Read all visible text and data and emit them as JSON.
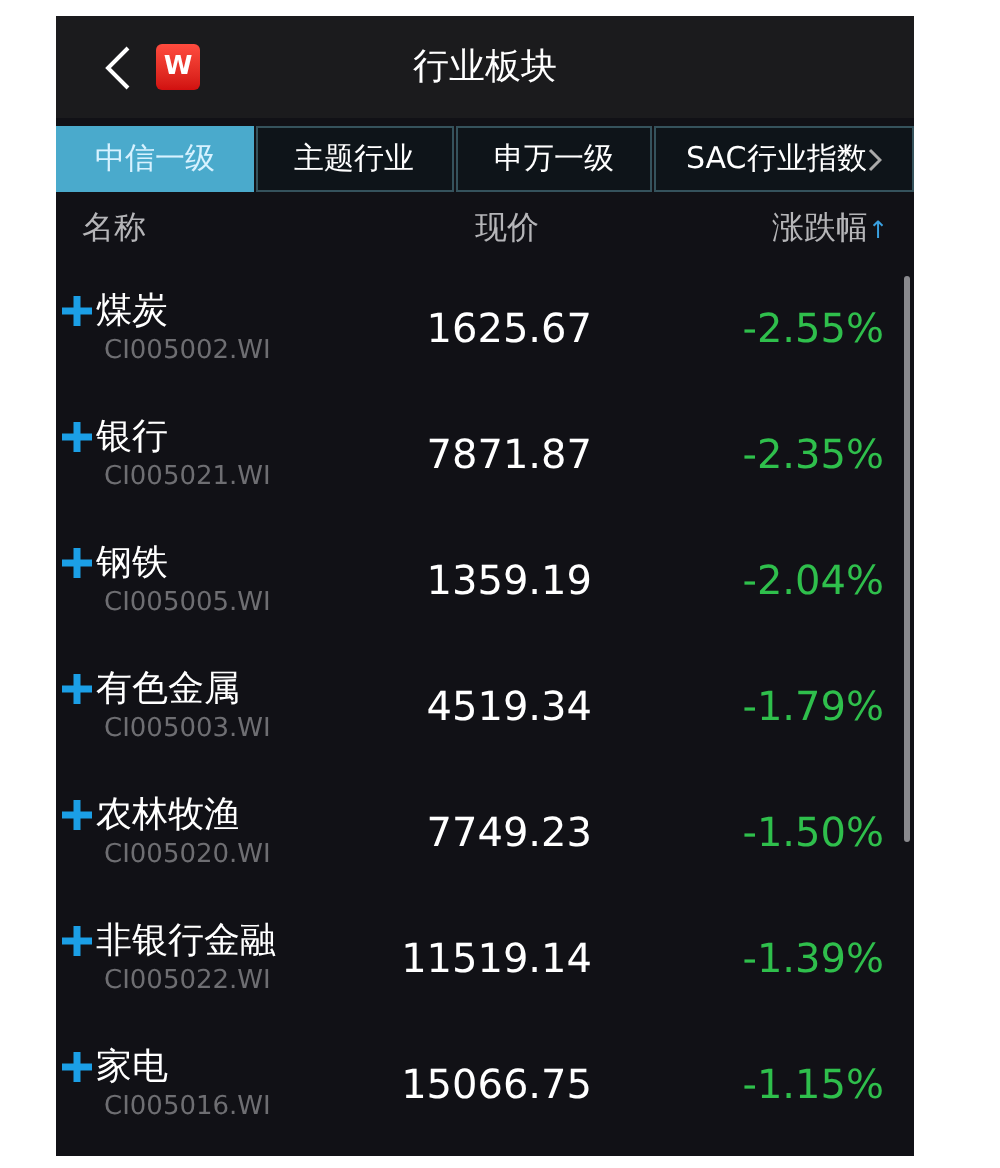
{
  "header": {
    "title": "行业板块",
    "logo_text": "W"
  },
  "tabs": [
    {
      "label": "中信一级",
      "selected": true
    },
    {
      "label": "主题行业",
      "selected": false
    },
    {
      "label": "申万一级",
      "selected": false
    },
    {
      "label": "SAC行业指数",
      "selected": false
    }
  ],
  "table": {
    "columns": [
      "名称",
      "现价",
      "涨跌幅"
    ],
    "sort_indicator": "↑",
    "rows": [
      {
        "name": "煤炭",
        "code": "CI005002.WI",
        "price": "1625.67",
        "change": "-2.55%"
      },
      {
        "name": "银行",
        "code": "CI005021.WI",
        "price": "7871.87",
        "change": "-2.35%"
      },
      {
        "name": "钢铁",
        "code": "CI005005.WI",
        "price": "1359.19",
        "change": "-2.04%"
      },
      {
        "name": "有色金属",
        "code": "CI005003.WI",
        "price": "4519.34",
        "change": "-1.79%"
      },
      {
        "name": "农林牧渔",
        "code": "CI005020.WI",
        "price": "7749.23",
        "change": "-1.50%"
      },
      {
        "name": "非银行金融",
        "code": "CI005022.WI",
        "price": "11519.14",
        "change": "-1.39%"
      },
      {
        "name": "家电",
        "code": "CI005016.WI",
        "price": "15066.75",
        "change": "-1.15%"
      }
    ]
  }
}
